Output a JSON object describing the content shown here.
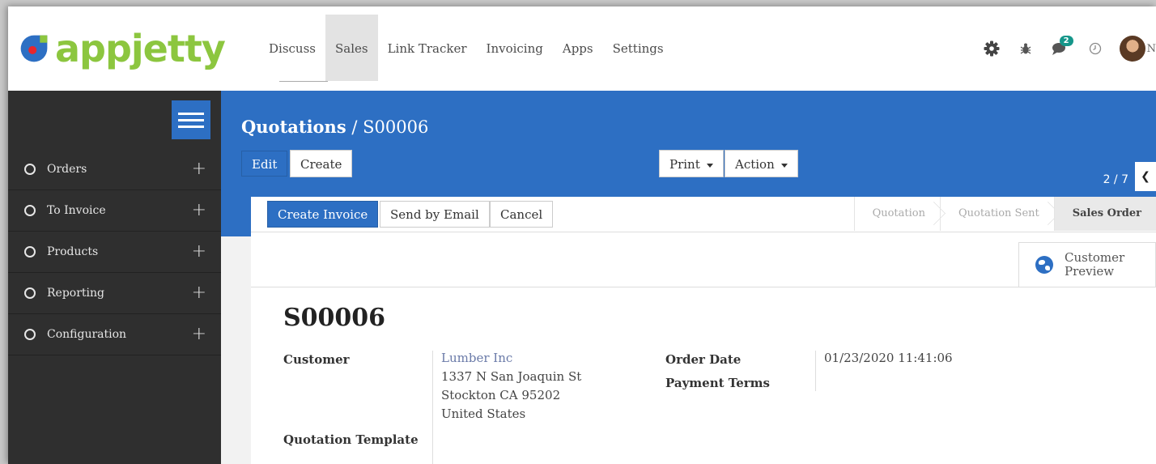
{
  "brand": {
    "logo_text": "appjetty",
    "logo_colors": {
      "orange": "#f39324",
      "green": "#8cc63f",
      "blue": "#2d6fc3",
      "red": "#e8262b"
    }
  },
  "menu": {
    "items": [
      "Discuss",
      "Sales",
      "Link Tracker",
      "Invoicing",
      "Apps",
      "Settings"
    ],
    "active": "Sales"
  },
  "systray": {
    "icons": [
      "gear-icon",
      "bug-icon",
      "chat-icon",
      "clock-icon"
    ],
    "chat_badge": "2",
    "user_initial": "N"
  },
  "sidebar": {
    "items": [
      {
        "label": "Orders"
      },
      {
        "label": "To Invoice"
      },
      {
        "label": "Products"
      },
      {
        "label": "Reporting"
      },
      {
        "label": "Configuration"
      }
    ]
  },
  "breadcrumb": {
    "parent": "Quotations",
    "separator": "/",
    "current": "S00006"
  },
  "actions": {
    "edit": "Edit",
    "create": "Create",
    "print": "Print",
    "action": "Action"
  },
  "pager": {
    "value": "2 / 7"
  },
  "header_buttons": {
    "create_invoice": "Create Invoice",
    "send_email": "Send by Email",
    "cancel": "Cancel"
  },
  "statusbar": {
    "stages": [
      "Quotation",
      "Quotation Sent",
      "Sales Order"
    ],
    "current": "Sales Order"
  },
  "smart_button": {
    "line1": "Customer",
    "line2": "Preview"
  },
  "form": {
    "name": "S00006",
    "customer_label": "Customer",
    "customer_name": "Lumber Inc",
    "address": [
      "1337 N San Joaquin St",
      "Stockton CA 95202",
      "United States"
    ],
    "order_date_label": "Order Date",
    "order_date": "01/23/2020 11:41:06",
    "payment_terms_label": "Payment Terms",
    "template_label": "Quotation Template"
  },
  "colors": {
    "primary": "#2d6fc3",
    "sidebar": "#2f2f2f",
    "badge": "#15968a"
  }
}
